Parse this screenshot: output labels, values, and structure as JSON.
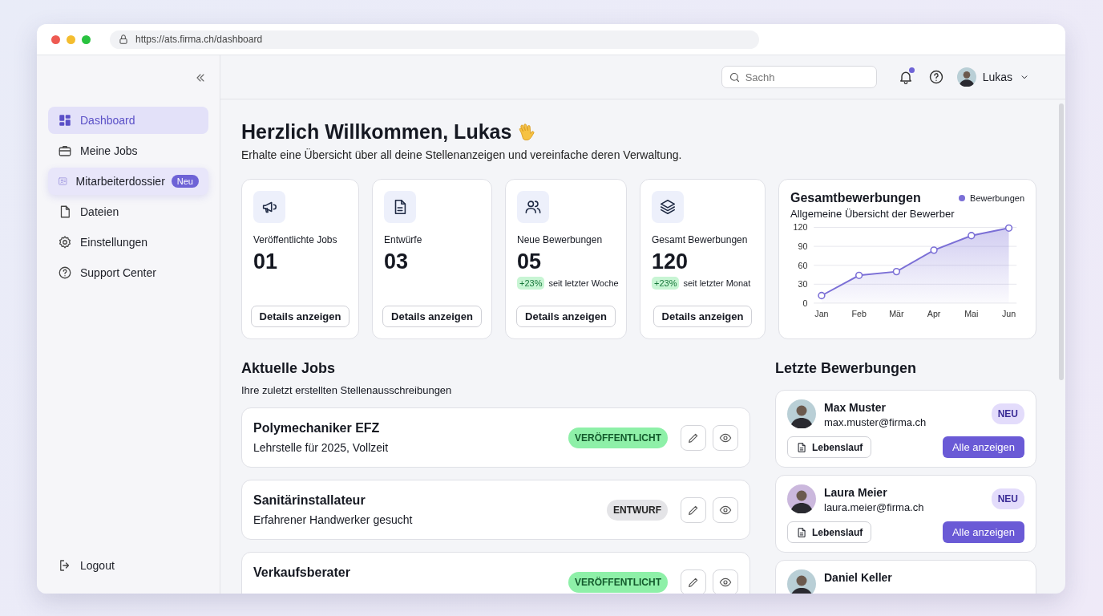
{
  "browser": {
    "url": "https://ats.firma.ch/dashboard"
  },
  "sidebar": {
    "items": [
      {
        "label": "Dashboard",
        "selected": true,
        "hovered": false
      },
      {
        "label": "Meine Jobs",
        "selected": false,
        "hovered": false
      },
      {
        "label": "Mitarbeiterdossier",
        "selected": false,
        "hovered": true,
        "badge": "Neu"
      },
      {
        "label": "Dateien",
        "selected": false,
        "hovered": false
      },
      {
        "label": "Einstellungen",
        "selected": false,
        "hovered": false
      },
      {
        "label": "Support Center",
        "selected": false,
        "hovered": false
      }
    ],
    "logout": "Logout"
  },
  "topbar": {
    "search": {
      "placeholder": "Sachh"
    },
    "notifications_unread": true,
    "user": "Lukas"
  },
  "welcome": {
    "title": "Herzlich Willkommen, Lukas",
    "subtitle": "Erhalte eine Übersicht über all deine Stellenanzeigen und vereinfache deren Verwaltung."
  },
  "stats": [
    {
      "label": "Veröffentlichte Jobs",
      "value": "01",
      "button": "Details anzeigen"
    },
    {
      "label": "Entwürfe",
      "value": "03",
      "button": "Details anzeigen"
    },
    {
      "label": "Neue Bewerbungen",
      "value": "05",
      "change": "+23%",
      "period": "seit letzter Woche",
      "button": "Details anzeigen"
    },
    {
      "label": "Gesamt Bewerbungen",
      "value": "120",
      "change": "+23%",
      "period": "seit letzter Monat",
      "button": "Details anzeigen"
    }
  ],
  "chart_card": {
    "title": "Gesamtbewerbungen",
    "subtitle": "Allgemeine Übersicht der Bewerber",
    "chart_data": {
      "type": "area",
      "categories": [
        "Jan",
        "Feb",
        "Mär",
        "Apr",
        "Mai",
        "Jun"
      ],
      "series": [
        {
          "name": "Bewerbungen",
          "color": "#7b6fd6",
          "values": [
            12,
            44,
            50,
            84,
            107,
            119
          ]
        }
      ],
      "ylim": [
        0,
        120
      ],
      "yticks": [
        0,
        30,
        60,
        90,
        120
      ],
      "grid": true
    }
  },
  "jobs": {
    "title": "Aktuelle Jobs",
    "subtitle": "Ihre zuletzt erstellten Stellenausschreibungen",
    "items": [
      {
        "title": "Polymechaniker EFZ",
        "subtitle": "Lehrstelle für 2025, Vollzeit",
        "status": {
          "kind": "published",
          "label": "VERÖFFENTLICHT"
        }
      },
      {
        "title": "Sanitärinstallateur",
        "subtitle": "Erfahrener Handwerker gesucht",
        "status": {
          "kind": "draft",
          "label": "ENTWURF"
        }
      },
      {
        "title": "Verkaufsberater",
        "status": {
          "kind": "published",
          "label": "VERÖFFENTLICHT"
        }
      }
    ]
  },
  "applications": {
    "title": "Letzte Bewerbungen",
    "items": [
      {
        "name": "Max Muster",
        "email": "max.muster@firma.ch",
        "badge": "NEU",
        "cv_button": "Lebenslauf",
        "action_button": "Alle anzeigen"
      },
      {
        "name": "Laura Meier",
        "email": "laura.meier@firma.ch",
        "badge": "NEU",
        "cv_button": "Lebenslauf",
        "action_button": "Alle anzeigen"
      },
      {
        "name": "Daniel Keller"
      }
    ]
  }
}
